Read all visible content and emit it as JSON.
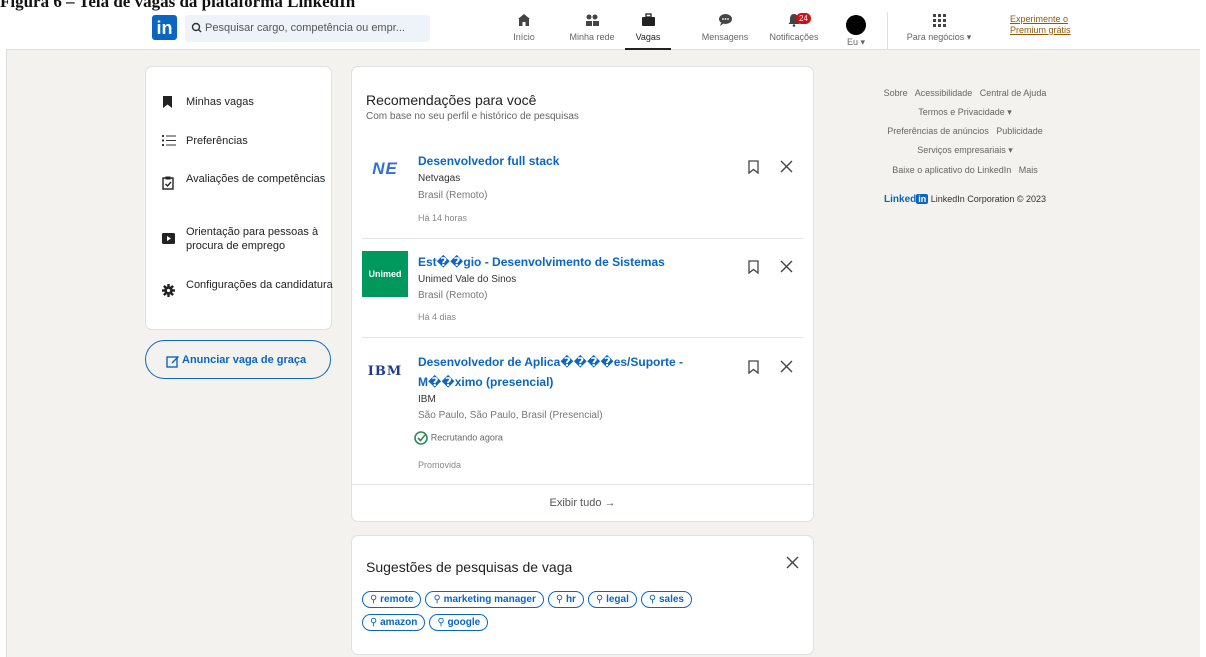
{
  "caption": "Figura 6 – Tela de vagas da plataforma LinkedIn",
  "header": {
    "logo_text": "in",
    "search_placeholder": "Pesquisar cargo, competência ou empr...",
    "nav": [
      {
        "label": "Início",
        "icon": "home-icon"
      },
      {
        "label": "Minha rede",
        "icon": "network-icon"
      },
      {
        "label": "Vagas",
        "icon": "briefcase-icon"
      },
      {
        "label": "Mensagens",
        "icon": "messaging-icon"
      },
      {
        "label": "Notificações",
        "icon": "bell-icon",
        "badge": "24"
      },
      {
        "label": "Eu ▾",
        "icon": "avatar"
      },
      {
        "label": "Para negócios ▾",
        "icon": "grid-icon"
      }
    ],
    "premium": "Experimente o Premium grátis"
  },
  "left": {
    "items": [
      {
        "label": "Minhas vagas",
        "icon": "bookmark-icon"
      },
      {
        "label": "Preferências",
        "icon": "list-icon"
      },
      {
        "label": "Avaliações de competências",
        "icon": "clipboard-check-icon"
      },
      {
        "label": "Orientação para pessoas à procura de emprego",
        "icon": "video-icon"
      },
      {
        "label": "Configurações da candidatura",
        "icon": "gear-icon"
      }
    ],
    "post_job": "Anunciar vaga de graça"
  },
  "recommendations": {
    "title": "Recomendações para você",
    "subtitle": "Com base no seu perfil e histórico de pesquisas",
    "jobs": [
      {
        "title": "Desenvolvedor full stack",
        "company": "Netvagas",
        "location": "Brasil (Remoto)",
        "time": "Há 14 horas",
        "logo": "NE"
      },
      {
        "title": "Est��gio - Desenvolvimento de Sistemas",
        "company": "Unimed Vale do Sinos",
        "location": "Brasil (Remoto)",
        "time": "Há 4 dias",
        "logo": "Unimed"
      },
      {
        "title_l1": "Desenvolvedor de Aplica����es/Suporte -",
        "title_l2": "M��ximo (presencial)",
        "company": "IBM",
        "location": "São Paulo, São Paulo, Brasil (Presencial)",
        "recruiting": "Recrutando agora",
        "promoted": "Promovida",
        "logo": "IBM"
      }
    ],
    "show_all": "Exibir tudo →"
  },
  "suggestions": {
    "title": "Sugestões de pesquisas de vaga",
    "chips": [
      "remote",
      "marketing manager",
      "hr",
      "legal",
      "sales",
      "amazon",
      "google"
    ]
  },
  "right": {
    "l1a": "Sobre",
    "l1b": "Acessibilidade",
    "l1c": "Central de Ajuda",
    "l2": "Termos e Privacidade ▾",
    "l3a": "Preferências de anúncios",
    "l3b": "Publicidade",
    "l4": "Serviços empresariais ▾",
    "l5a": "Baixe o aplicativo do LinkedIn",
    "l5b": "Mais",
    "brand": "Linked",
    "brand_in": "in",
    "copyright": "LinkedIn Corporation © 2023"
  }
}
